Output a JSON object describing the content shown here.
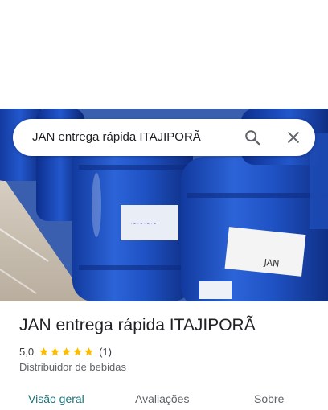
{
  "search": {
    "query": "JAN entrega rápida ITAJIPORÃ",
    "search_icon": "search-icon",
    "close_icon": "close-icon"
  },
  "place": {
    "name": "JAN entrega rápida ITAJIPORÃ",
    "rating": "5,0",
    "stars": 5,
    "review_count": "(1)",
    "category": "Distribuidor de bebidas"
  },
  "tabs": [
    {
      "label": "Visão geral",
      "active": true
    },
    {
      "label": "Avaliações",
      "active": false
    },
    {
      "label": "Sobre",
      "active": false
    }
  ],
  "photo": {
    "description_icon": "water-jugs-photo"
  },
  "colors": {
    "star": "#fbbc04",
    "active_tab": "#1a7379",
    "inactive_tab": "#5f6368",
    "title": "#202124"
  }
}
